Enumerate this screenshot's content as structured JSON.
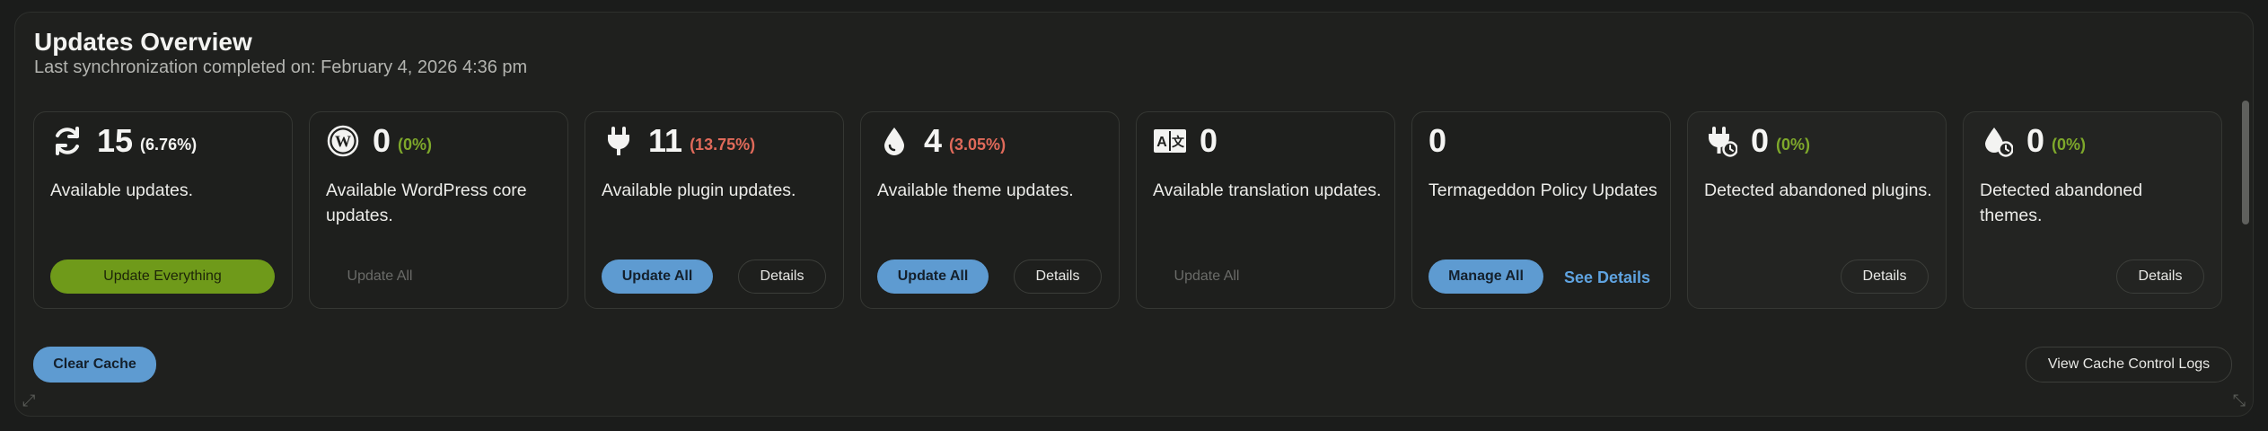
{
  "header": {
    "title": "Updates Overview",
    "subtitle": "Last synchronization completed on: February 4, 2026 4:36 pm"
  },
  "cards": [
    {
      "icon": "refresh-icon",
      "count": "15",
      "pct": "(6.76%)",
      "pct_color": "#f3f3f1",
      "label": "Available updates.",
      "primary": "Update Everything",
      "secondary": ""
    },
    {
      "icon": "wordpress-icon",
      "count": "0",
      "pct": "(0%)",
      "pct_color": "#7ea82b",
      "label": "Available WordPress core updates.",
      "primary": "Update All",
      "secondary": ""
    },
    {
      "icon": "plugin-icon",
      "count": "11",
      "pct": "(13.75%)",
      "pct_color": "#e06a5a",
      "label": "Available plugin updates.",
      "primary": "Update All",
      "secondary": "Details"
    },
    {
      "icon": "theme-drop-icon",
      "count": "4",
      "pct": "(3.05%)",
      "pct_color": "#e06a5a",
      "label": "Available theme updates.",
      "primary": "Update All",
      "secondary": "Details"
    },
    {
      "icon": "translation-icon",
      "count": "0",
      "pct": "",
      "pct_color": "",
      "label": "Available translation updates.",
      "primary": "Update All",
      "secondary": ""
    },
    {
      "icon": "",
      "count": "0",
      "pct": "",
      "pct_color": "",
      "label": "Termageddon Policy Updates",
      "primary": "Manage All",
      "secondary": "See Details"
    },
    {
      "icon": "abandoned-plugin-icon",
      "count": "0",
      "pct": "(0%)",
      "pct_color": "#7ea82b",
      "label": "Detected abandoned plugins.",
      "primary": "",
      "secondary": "Details"
    },
    {
      "icon": "abandoned-theme-icon",
      "count": "0",
      "pct": "(0%)",
      "pct_color": "#7ea82b",
      "label": "Detected abandoned themes.",
      "primary": "",
      "secondary": "Details"
    }
  ],
  "footer": {
    "clear_cache": "Clear Cache",
    "view_logs": "View Cache Control Logs"
  },
  "colors": {
    "accent_blue": "#5e9bd1",
    "accent_green": "#6f9a1a",
    "link_blue": "#5fa3e0"
  }
}
